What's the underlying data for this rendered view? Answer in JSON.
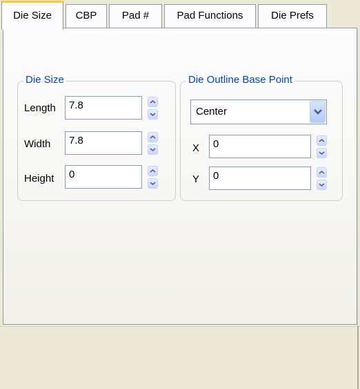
{
  "tabs": [
    {
      "label": "Die Size",
      "active": true
    },
    {
      "label": "CBP",
      "active": false
    },
    {
      "label": "Pad #",
      "active": false
    },
    {
      "label": "Pad Functions",
      "active": false
    },
    {
      "label": "Die Prefs",
      "active": false
    }
  ],
  "die_size": {
    "legend": "Die Size",
    "length": {
      "label": "Length",
      "value": "7.8"
    },
    "width": {
      "label": "Width",
      "value": "7.8"
    },
    "height": {
      "label": "Height",
      "value": "0"
    }
  },
  "base_point": {
    "legend": "Die Outline Base Point",
    "selected": "Center",
    "x": {
      "label": "X",
      "value": "0"
    },
    "y": {
      "label": "Y",
      "value": "0"
    }
  },
  "icons": {
    "spin_up": "chevron-up-icon",
    "spin_down": "chevron-down-icon",
    "dropdown": "chevron-down-icon"
  },
  "colors": {
    "legend": "#0046d5",
    "active_tab_accent": "#ffc83c",
    "field_border": "#7f9db9"
  }
}
